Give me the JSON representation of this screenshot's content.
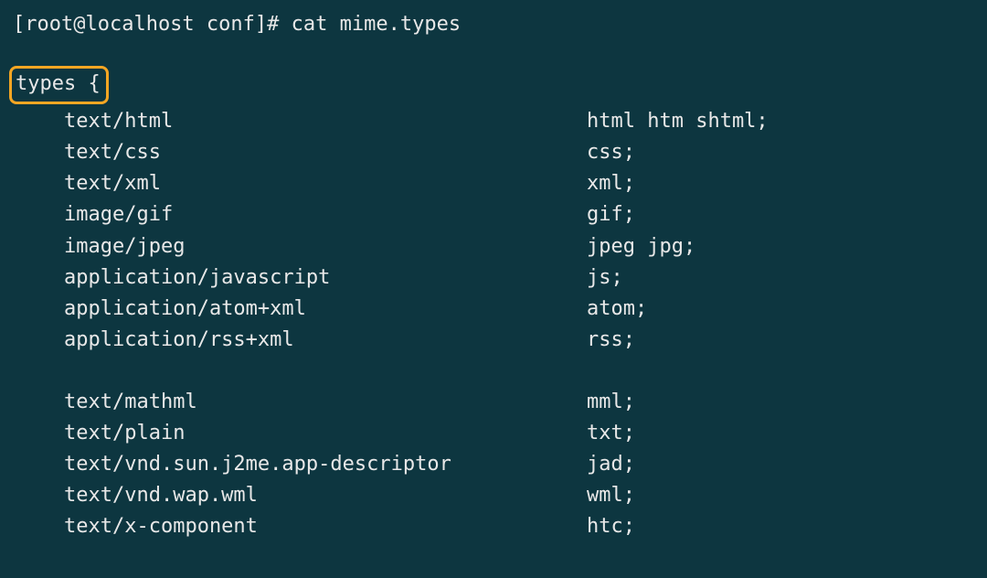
{
  "prompt": "[root@localhost conf]# cat mime.types",
  "types_open": "types {",
  "rows_group1": [
    {
      "type": "text/html",
      "ext": "html htm shtml;"
    },
    {
      "type": "text/css",
      "ext": "css;"
    },
    {
      "type": "text/xml",
      "ext": "xml;"
    },
    {
      "type": "image/gif",
      "ext": "gif;"
    },
    {
      "type": "image/jpeg",
      "ext": "jpeg jpg;"
    },
    {
      "type": "application/javascript",
      "ext": "js;"
    },
    {
      "type": "application/atom+xml",
      "ext": "atom;"
    },
    {
      "type": "application/rss+xml",
      "ext": "rss;"
    }
  ],
  "rows_group2": [
    {
      "type": "text/mathml",
      "ext": "mml;"
    },
    {
      "type": "text/plain",
      "ext": "txt;"
    },
    {
      "type": "text/vnd.sun.j2me.app-descriptor",
      "ext": "jad;"
    },
    {
      "type": "text/vnd.wap.wml",
      "ext": "wml;"
    },
    {
      "type": "text/x-component",
      "ext": "htc;"
    }
  ]
}
